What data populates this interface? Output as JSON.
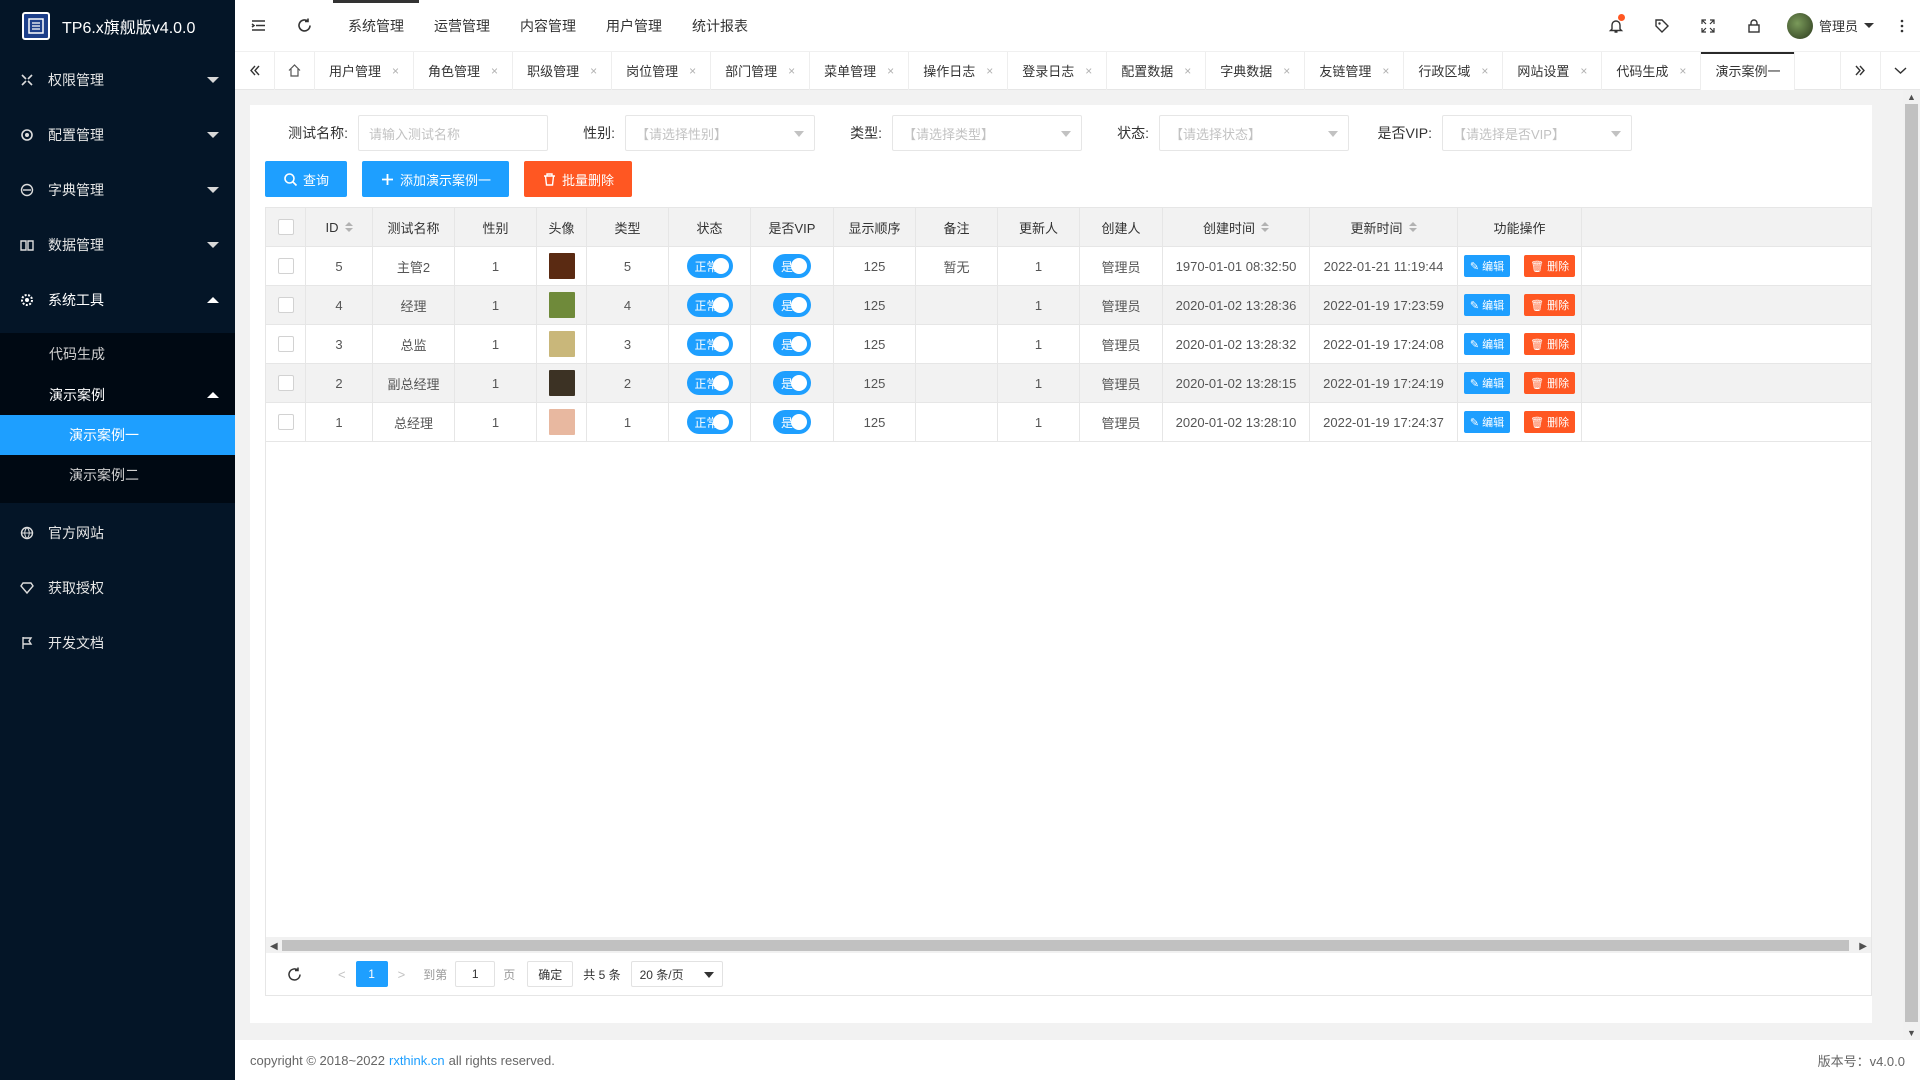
{
  "app": {
    "title": "TP6.x旗舰版v4.0.0"
  },
  "sidebar": {
    "items": [
      {
        "label": "权限管理",
        "icon": "permission-icon",
        "open": false
      },
      {
        "label": "配置管理",
        "icon": "gear-icon",
        "open": false
      },
      {
        "label": "字典管理",
        "icon": "dictionary-icon",
        "open": false
      },
      {
        "label": "数据管理",
        "icon": "book-icon",
        "open": false
      },
      {
        "label": "系统工具",
        "icon": "tool-gear-icon",
        "open": true
      }
    ],
    "sub": [
      {
        "label": "代码生成"
      },
      {
        "label": "演示案例"
      }
    ],
    "subsub": [
      {
        "label": "演示案例一",
        "active": true
      },
      {
        "label": "演示案例二",
        "active": false
      }
    ],
    "bottom": [
      {
        "label": "官方网站",
        "icon": "globe-icon"
      },
      {
        "label": "获取授权",
        "icon": "diamond-icon"
      },
      {
        "label": "开发文档",
        "icon": "flag-icon"
      }
    ]
  },
  "topnav": {
    "items": [
      "系统管理",
      "运营管理",
      "内容管理",
      "用户管理",
      "统计报表"
    ],
    "active_index": 0,
    "user": "管理员"
  },
  "tabs": {
    "items": [
      "用户管理",
      "角色管理",
      "职级管理",
      "岗位管理",
      "部门管理",
      "菜单管理",
      "操作日志",
      "登录日志",
      "配置数据",
      "字典数据",
      "友链管理",
      "行政区域",
      "网站设置",
      "代码生成",
      "演示案例一"
    ],
    "active_index": 14,
    "close_glyph": "×"
  },
  "search": {
    "name_label": "测试名称:",
    "name_placeholder": "请输入测试名称",
    "gender_label": "性别:",
    "gender_placeholder": "【请选择性别】",
    "type_label": "类型:",
    "type_placeholder": "【请选择类型】",
    "status_label": "状态:",
    "status_placeholder": "【请选择状态】",
    "vip_label": "是否VIP:",
    "vip_placeholder": "【请选择是否VIP】"
  },
  "buttons": {
    "query": "查询",
    "add": "添加演示案例一",
    "batch_delete": "批量删除"
  },
  "table": {
    "columns": [
      "ID",
      "测试名称",
      "性别",
      "头像",
      "类型",
      "状态",
      "是否VIP",
      "显示顺序",
      "备注",
      "更新人",
      "创建人",
      "创建时间",
      "更新时间",
      "功能操作"
    ],
    "rows": [
      {
        "id": "5",
        "name": "主管2",
        "gender": "1",
        "avatar_color": "#5a2a12",
        "type": "5",
        "status": "正常",
        "vip": "是",
        "order": "125",
        "note": "暂无",
        "updater": "1",
        "creator": "管理员",
        "created": "1970-01-01 08:32:50",
        "updated": "2022-01-21 11:19:44"
      },
      {
        "id": "4",
        "name": "经理",
        "gender": "1",
        "avatar_color": "#6f8a3a",
        "type": "4",
        "status": "正常",
        "vip": "是",
        "order": "125",
        "note": "",
        "updater": "1",
        "creator": "管理员",
        "created": "2020-01-02 13:28:36",
        "updated": "2022-01-19 17:23:59"
      },
      {
        "id": "3",
        "name": "总监",
        "gender": "1",
        "avatar_color": "#c9b77a",
        "type": "3",
        "status": "正常",
        "vip": "是",
        "order": "125",
        "note": "",
        "updater": "1",
        "creator": "管理员",
        "created": "2020-01-02 13:28:32",
        "updated": "2022-01-19 17:24:08"
      },
      {
        "id": "2",
        "name": "副总经理",
        "gender": "1",
        "avatar_color": "#3c3224",
        "type": "2",
        "status": "正常",
        "vip": "是",
        "order": "125",
        "note": "",
        "updater": "1",
        "creator": "管理员",
        "created": "2020-01-02 13:28:15",
        "updated": "2022-01-19 17:24:19"
      },
      {
        "id": "1",
        "name": "总经理",
        "gender": "1",
        "avatar_color": "#e8b8a0",
        "type": "1",
        "status": "正常",
        "vip": "是",
        "order": "125",
        "note": "",
        "updater": "1",
        "creator": "管理员",
        "created": "2020-01-02 13:28:10",
        "updated": "2022-01-19 17:24:37"
      }
    ],
    "edit_label": "编辑",
    "delete_label": "删除"
  },
  "pager": {
    "current": "1",
    "goto_label": "到第",
    "goto_value": "1",
    "page_label": "页",
    "confirm": "确定",
    "total": "共 5 条",
    "limit": "20 条/页"
  },
  "footer": {
    "prefix": "copyright © 2018~2022",
    "link": "rxthink.cn",
    "suffix": "all rights reserved.",
    "version": "版本号：v4.0.0"
  },
  "colors": {
    "primary": "#1E9FFF",
    "danger": "#FF5722",
    "sidebar": "#041527"
  }
}
